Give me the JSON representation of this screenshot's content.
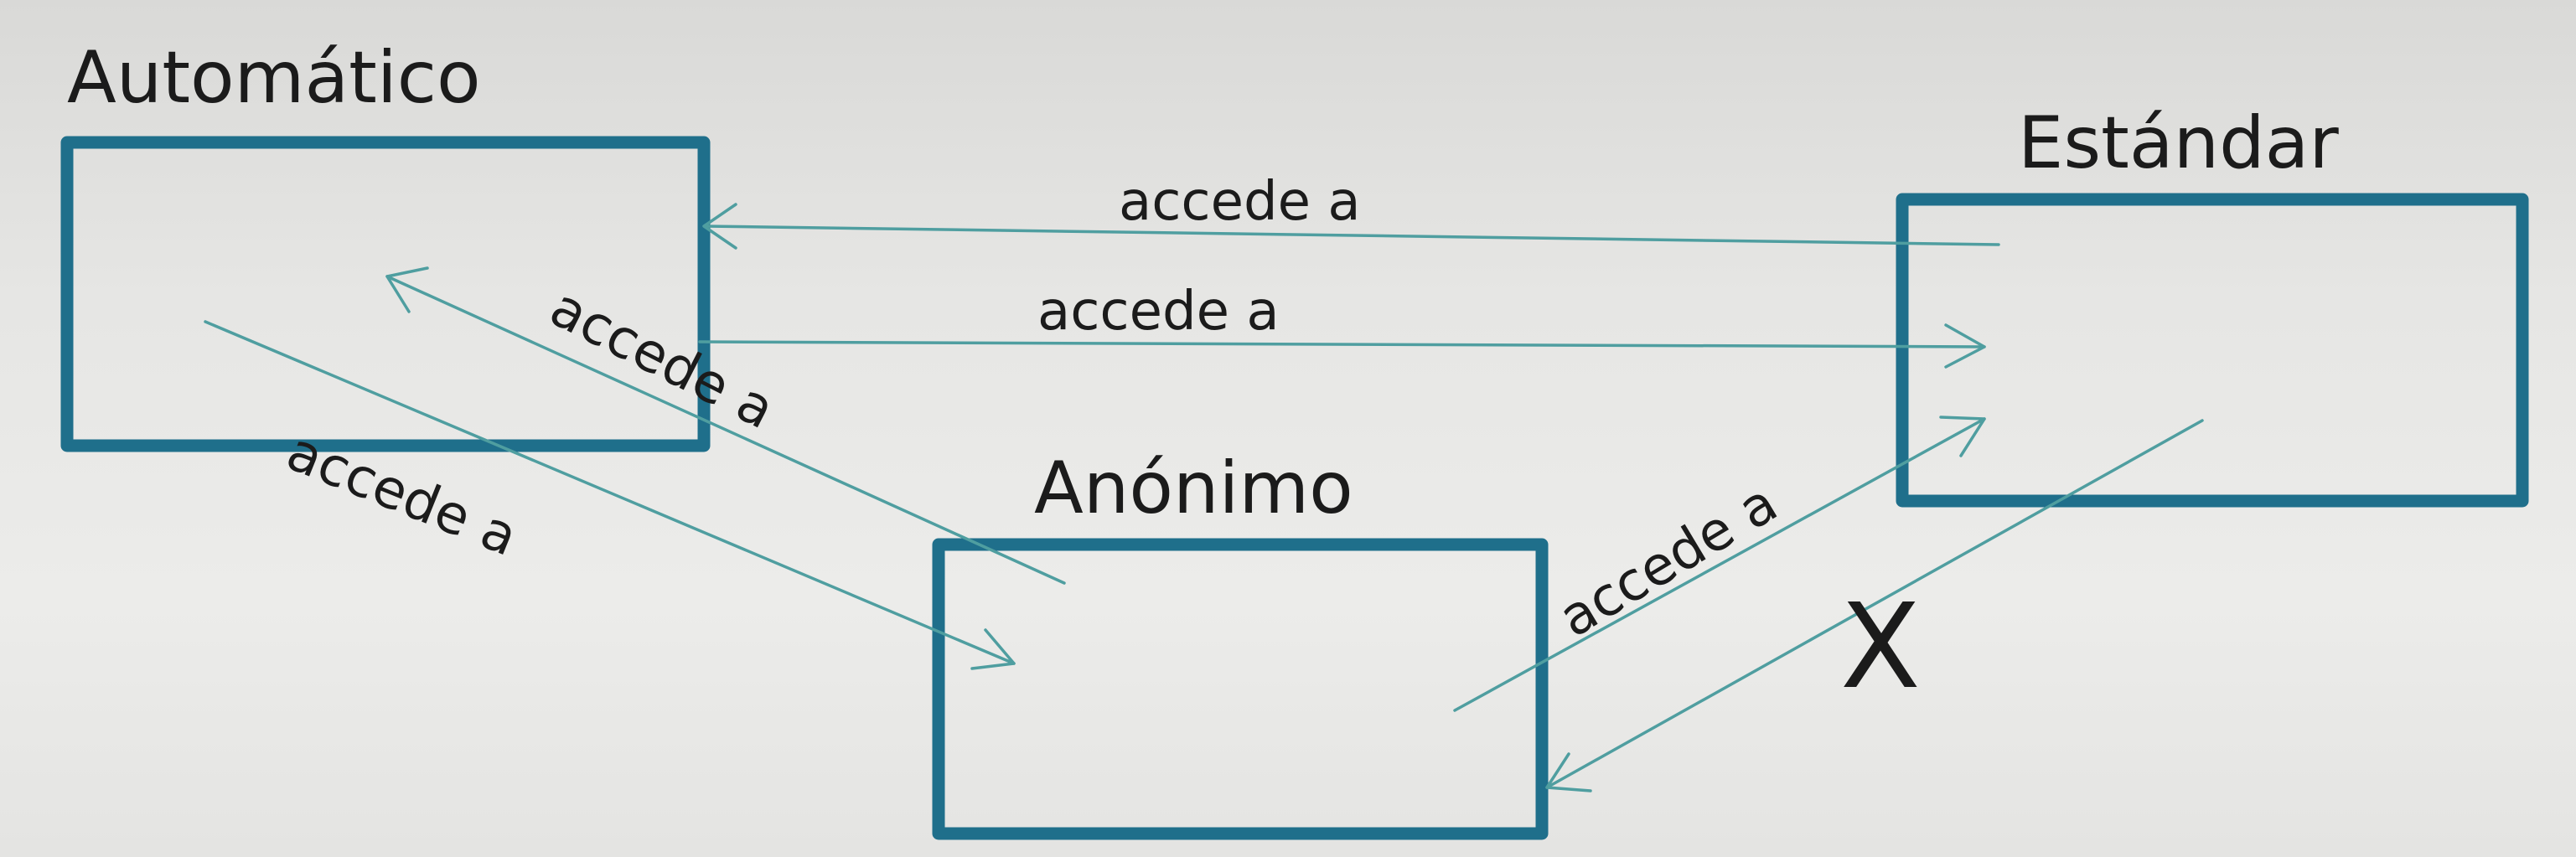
{
  "nodes": {
    "automatico": {
      "label": "Automático"
    },
    "estandar": {
      "label": "Estándar"
    },
    "anonimo": {
      "label": "Anónimo"
    }
  },
  "edges": [
    {
      "from": "Estándar",
      "to": "Automático",
      "label": "accede a"
    },
    {
      "from": "Automático",
      "to": "Estándar",
      "label": "accede a"
    },
    {
      "from": "Anónimo",
      "to": "Automático",
      "label": "accede a"
    },
    {
      "from": "Automático",
      "to": "Anónimo",
      "label": "accede a"
    },
    {
      "from": "Anónimo",
      "to": "Estándar",
      "label": "accede a"
    },
    {
      "from": "Estándar",
      "to": "Anónimo",
      "label": "",
      "marker": "X"
    }
  ],
  "colors": {
    "box_stroke": "#1f6f8b",
    "edge_stroke": "#4f9ea0",
    "text": "#1b1b1b"
  }
}
